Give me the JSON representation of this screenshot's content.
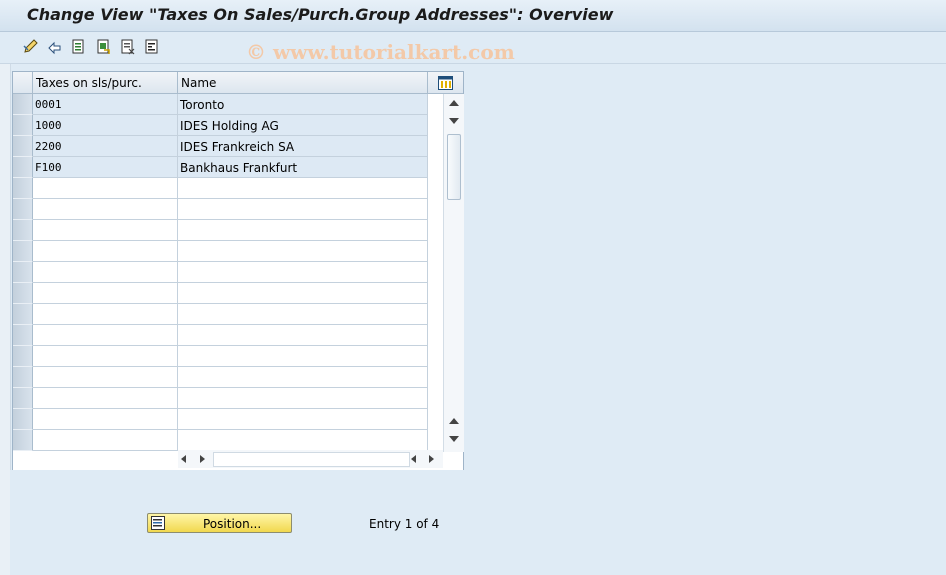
{
  "window": {
    "title": "Change View \"Taxes On Sales/Purch.Group Addresses\": Overview"
  },
  "toolbar": {
    "buttons": [
      {
        "icon": "edit-pencil-icon"
      },
      {
        "icon": "undo-icon"
      },
      {
        "icon": "new-entries-icon"
      },
      {
        "icon": "copy-as-icon"
      },
      {
        "icon": "delete-icon"
      },
      {
        "icon": "select-all-icon"
      }
    ]
  },
  "watermark": "© www.tutorialkart.com",
  "table": {
    "columns": [
      "Taxes on sls/purc.",
      "Name"
    ],
    "rows": [
      {
        "code": "0001",
        "name": "Toronto"
      },
      {
        "code": "1000",
        "name": "IDES Holding AG"
      },
      {
        "code": "2200",
        "name": "IDES Frankreich SA"
      },
      {
        "code": "F100",
        "name": "Bankhaus Frankfurt"
      }
    ],
    "empty_rows": 13
  },
  "footer": {
    "position_button": "Position...",
    "entry_info": "Entry 1 of 4"
  },
  "colors": {
    "title_bg": "#dfe9f3",
    "row_filled_bg": "#dde9f4",
    "button_yellow": "#f1d84f"
  }
}
